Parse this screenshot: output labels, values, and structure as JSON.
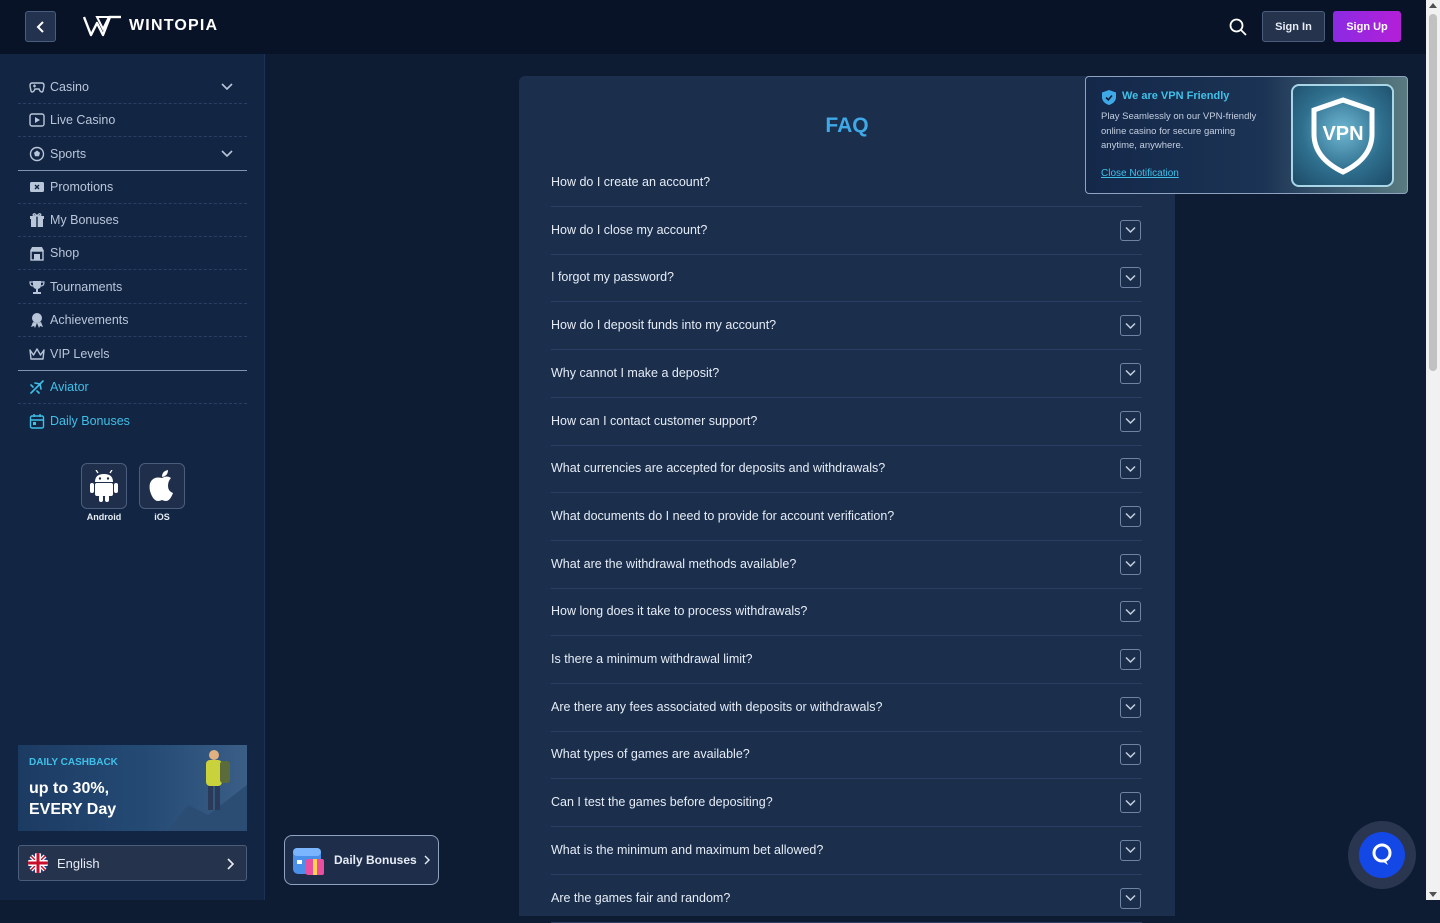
{
  "header": {
    "brand": "WINTOPIA",
    "signin_label": "Sign In",
    "signup_label": "Sign Up"
  },
  "sidebar": {
    "items": [
      {
        "label": "Casino",
        "icon": "gamepad-icon",
        "has_dropdown": true
      },
      {
        "label": "Live Casino",
        "icon": "play-icon"
      },
      {
        "label": "Sports",
        "icon": "soccer-ball-icon",
        "has_dropdown": true
      },
      {
        "label": "Promotions",
        "icon": "ticket-icon"
      },
      {
        "label": "My Bonuses",
        "icon": "gift-icon"
      },
      {
        "label": "Shop",
        "icon": "store-icon"
      },
      {
        "label": "Tournaments",
        "icon": "trophy-icon"
      },
      {
        "label": "Achievements",
        "icon": "medal-icon"
      },
      {
        "label": "VIP Levels",
        "icon": "crown-icon"
      },
      {
        "label": "Aviator",
        "icon": "plane-icon"
      },
      {
        "label": "Daily Bonuses",
        "icon": "calendar-icon"
      }
    ],
    "apps": [
      {
        "label": "Android",
        "icon": "android-icon"
      },
      {
        "label": "iOS",
        "icon": "apple-icon"
      }
    ],
    "promo": {
      "kicker": "DAILY CASHBACK",
      "title": "up to 30%, EVERY Day"
    },
    "language": "English"
  },
  "faq": {
    "title": "FAQ",
    "questions": [
      "How do I create an account?",
      "How do I close my account?",
      "I forgot my password?",
      "How do I deposit funds into my account?",
      "Why cannot I make a deposit?",
      "How can I contact customer support?",
      "What currencies are accepted for deposits and withdrawals?",
      "What documents do I need to provide for account verification?",
      "What are the withdrawal methods available?",
      "How long does it take to process withdrawals?",
      "Is there a minimum withdrawal limit?",
      "Are there any fees associated with deposits or withdrawals?",
      "What types of games are available?",
      "Can I test the games before depositing?",
      "What is the minimum and maximum bet allowed?",
      "Are the games fair and random?"
    ]
  },
  "vpn_notice": {
    "title": "We are VPN Friendly",
    "body": "Play Seamlessly on our VPN-friendly online casino for secure gaming anytime, anywhere.",
    "close_label": "Close Notification",
    "badge_text": "VPN"
  },
  "floating": {
    "daily_bonuses_label": "Daily Bonuses"
  },
  "colors": {
    "accent": "#3fc0e8",
    "faq_title": "#3fa9e8",
    "signup": "#b41fd8",
    "chat": "#1448e6"
  }
}
